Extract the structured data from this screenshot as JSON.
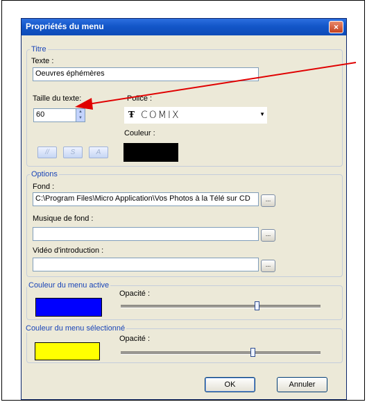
{
  "dialog": {
    "title": "Propriétés du menu",
    "close_label": "×"
  },
  "titre": {
    "legend": "Titre",
    "text_label": "Texte :",
    "text_value": "Oeuvres éphémères",
    "size_label": "Taille du texte:",
    "size_value": "60",
    "font_label": "Police :",
    "font_icon": "Ŧ",
    "font_value": "COMIX",
    "color_label": "Couleur :",
    "color": "#000000"
  },
  "options": {
    "legend": "Options",
    "fond_label": "Fond :",
    "fond_value": "C:\\Program Files\\Micro Application\\Vos Photos à la Télé sur CD",
    "musique_label": "Musique de fond :",
    "musique_value": "",
    "video_label": "Vidéo d'introduction :",
    "video_value": "",
    "browse_label": "..."
  },
  "menu_active": {
    "legend": "Couleur du menu active",
    "opacity_label": "Opacité :",
    "color": "#0000ff",
    "opacity": 0.68
  },
  "menu_selected": {
    "legend": "Couleur du menu sélectionné",
    "opacity_label": "Opacité :",
    "color": "#ffff00",
    "opacity": 0.66
  },
  "buttons": {
    "ok": "OK",
    "cancel": "Annuler"
  },
  "colors": {
    "titlebar": "#1356c8",
    "annotation_arrow": "#e00000"
  }
}
